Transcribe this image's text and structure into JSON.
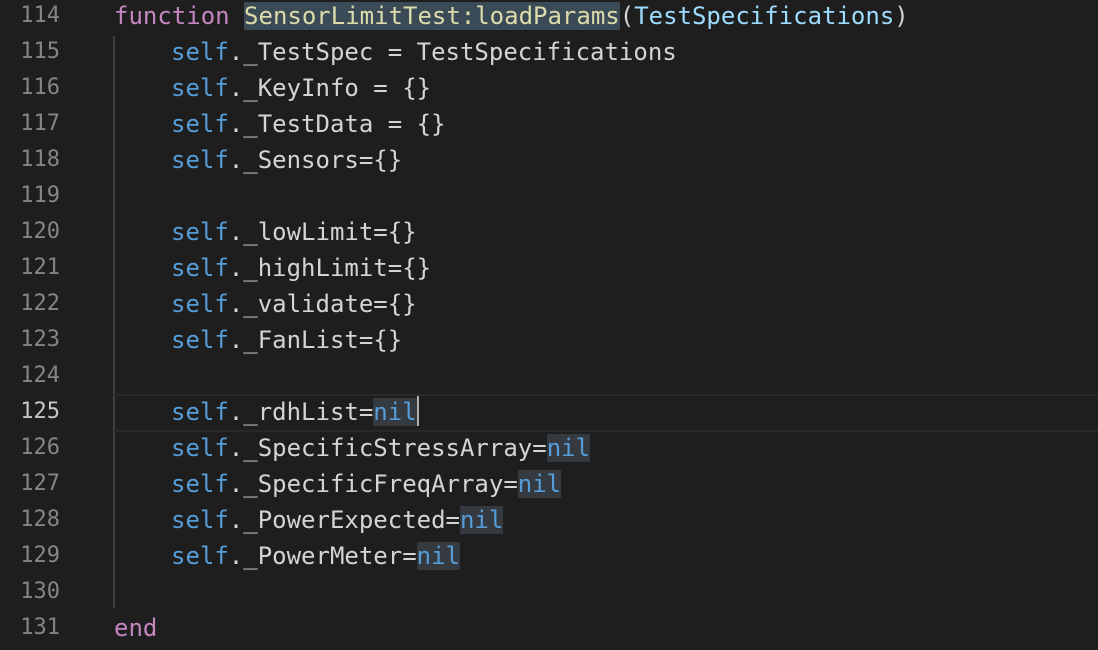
{
  "editor": {
    "language": "lua",
    "lines": [
      {
        "number": "114",
        "tokens": [
          {
            "t": "function",
            "c": "kw"
          },
          {
            "t": " ",
            "c": "ident"
          },
          {
            "t": "SensorLimitTest:loadParams",
            "c": "fn hl-fn"
          },
          {
            "t": "(",
            "c": "ident"
          },
          {
            "t": "TestSpecifications",
            "c": "param"
          },
          {
            "t": ")",
            "c": "ident"
          }
        ]
      },
      {
        "number": "115",
        "tokens": [
          {
            "t": "self",
            "c": "self"
          },
          {
            "t": "._TestSpec = TestSpecifications",
            "c": "ident"
          }
        ]
      },
      {
        "number": "116",
        "tokens": [
          {
            "t": "self",
            "c": "self"
          },
          {
            "t": "._KeyInfo = {}",
            "c": "ident"
          }
        ]
      },
      {
        "number": "117",
        "tokens": [
          {
            "t": "self",
            "c": "self"
          },
          {
            "t": "._TestData = {}",
            "c": "ident"
          }
        ]
      },
      {
        "number": "118",
        "tokens": [
          {
            "t": "self",
            "c": "self"
          },
          {
            "t": "._Sensors={}",
            "c": "ident"
          }
        ]
      },
      {
        "number": "119",
        "tokens": []
      },
      {
        "number": "120",
        "tokens": [
          {
            "t": "self",
            "c": "self"
          },
          {
            "t": "._lowLimit={}",
            "c": "ident"
          }
        ]
      },
      {
        "number": "121",
        "tokens": [
          {
            "t": "self",
            "c": "self"
          },
          {
            "t": "._highLimit={}",
            "c": "ident"
          }
        ]
      },
      {
        "number": "122",
        "tokens": [
          {
            "t": "self",
            "c": "self"
          },
          {
            "t": "._validate={}",
            "c": "ident"
          }
        ]
      },
      {
        "number": "123",
        "tokens": [
          {
            "t": "self",
            "c": "self"
          },
          {
            "t": "._FanList={}",
            "c": "ident"
          }
        ]
      },
      {
        "number": "124",
        "tokens": []
      },
      {
        "number": "125",
        "current": true,
        "tokens": [
          {
            "t": "self",
            "c": "self"
          },
          {
            "t": "._rdhList=",
            "c": "ident"
          },
          {
            "t": "nil",
            "c": "nil hl-word"
          }
        ]
      },
      {
        "number": "126",
        "tokens": [
          {
            "t": "self",
            "c": "self"
          },
          {
            "t": "._SpecificStressArray=",
            "c": "ident"
          },
          {
            "t": "nil",
            "c": "nil hl-word"
          }
        ]
      },
      {
        "number": "127",
        "tokens": [
          {
            "t": "self",
            "c": "self"
          },
          {
            "t": "._SpecificFreqArray=",
            "c": "ident"
          },
          {
            "t": "nil",
            "c": "nil hl-word"
          }
        ]
      },
      {
        "number": "128",
        "tokens": [
          {
            "t": "self",
            "c": "self"
          },
          {
            "t": "._PowerExpected=",
            "c": "ident"
          },
          {
            "t": "nil",
            "c": "nil hl-word"
          }
        ]
      },
      {
        "number": "129",
        "tokens": [
          {
            "t": "self",
            "c": "self"
          },
          {
            "t": "._PowerMeter=",
            "c": "ident"
          },
          {
            "t": "nil",
            "c": "nil hl-word"
          }
        ]
      },
      {
        "number": "130",
        "tokens": []
      },
      {
        "number": "131",
        "tokens": [
          {
            "t": "end",
            "c": "kw"
          }
        ]
      }
    ]
  }
}
